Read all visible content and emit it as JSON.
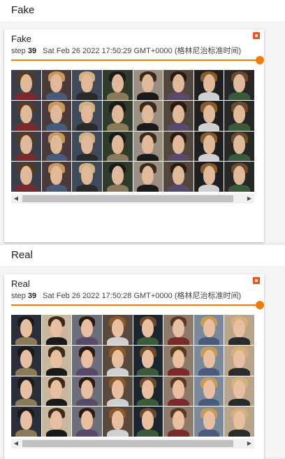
{
  "sections": [
    {
      "header": "Fake",
      "card": {
        "title": "Fake",
        "step_label": "step",
        "step_value": "39",
        "timestamp": "Sat Feb 26 2022 17:50:29 GMT+0000 (格林尼治标准时间)"
      }
    },
    {
      "header": "Real",
      "card": {
        "title": "Real",
        "step_label": "step",
        "step_value": "39",
        "timestamp": "Sat Feb 26 2022 17:50:28 GMT+0000 (格林尼治标准时间)"
      }
    }
  ],
  "icons": {
    "expand": "expand-icon",
    "scroll_left": "chevron-left-icon",
    "scroll_right": "chevron-right-icon"
  },
  "colors": {
    "accent": "#f57c00",
    "expand_button": "#f4511e"
  },
  "image_grid": {
    "rows": 4,
    "cols": 8
  }
}
